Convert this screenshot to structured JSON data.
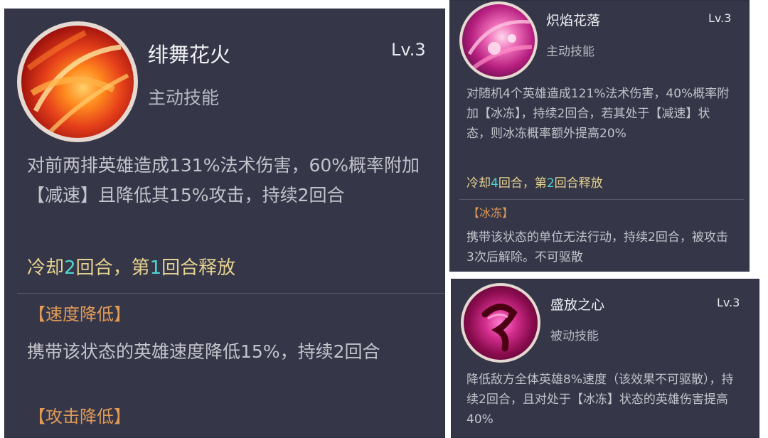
{
  "colors": {
    "panel_bg": "#353749",
    "cooldown_text": "#e6d28e",
    "cooldown_number": "#4fd6cf",
    "status_title": "#e29a55"
  },
  "cards": [
    {
      "icon": "fire-swirl-icon",
      "name": "绯舞花火",
      "level": "Lv.3",
      "type": "主动技能",
      "description": "对前两排英雄造成131%法术伤害，60%概率附加【减速】且降低其15%攻击，持续2回合",
      "cooldown": {
        "pre": "冷却",
        "cd_value": "2",
        "mid": "回合，第",
        "release_value": "1",
        "post": "回合释放"
      },
      "statuses": [
        {
          "title": "【速度降低】",
          "desc": "携带该状态的英雄速度降低15%，持续2回合"
        },
        {
          "title": "【攻击降低】",
          "desc": ""
        }
      ]
    },
    {
      "icon": "pink-blossom-vortex-icon",
      "name": "炽焰花落",
      "level": "Lv.3",
      "type": "主动技能",
      "description": "对随机4个英雄造成121%法术伤害，40%概率附加【冰冻】，持续2回合，若其处于【减速】状态，则冰冻概率额外提高20%",
      "cooldown": {
        "pre": "冷却",
        "cd_value": "4",
        "mid": "回合，第",
        "release_value": "2",
        "post": "回合释放"
      },
      "statuses": [
        {
          "title": "【冰冻】",
          "desc": "携带该状态的单位无法行动，持续2回合，被攻击3次后解除。不可驱散"
        }
      ]
    },
    {
      "icon": "crimson-heart-icon",
      "name": "盛放之心",
      "level": "Lv.3",
      "type": "被动技能",
      "description": "降低敌方全体英雄8%速度（该效果不可驱散），持续2回合，且对处于【冰冻】状态的英雄伤害提高40%"
    }
  ]
}
